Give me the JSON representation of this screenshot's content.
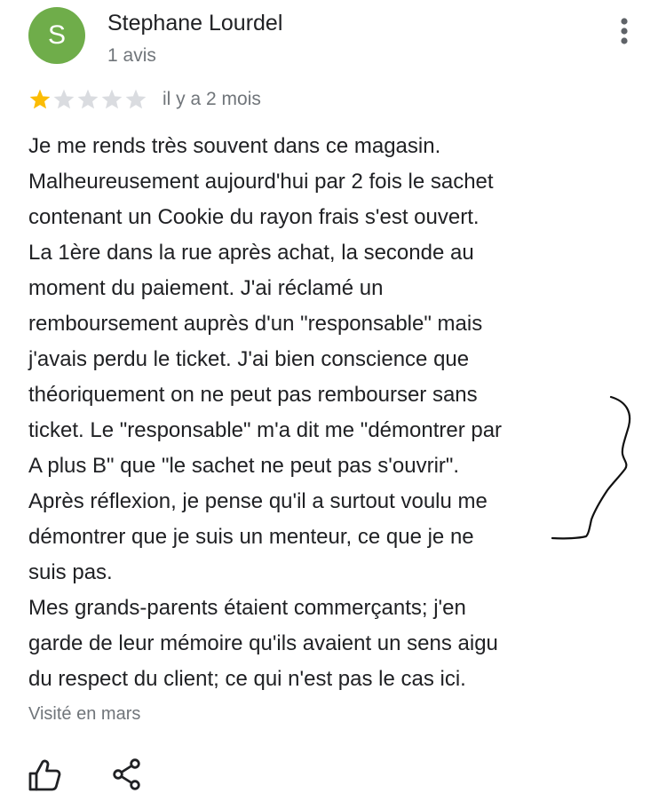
{
  "review": {
    "avatar_letter": "S",
    "avatar_color": "#6fad4a",
    "author_name": "Stephane Lourdel",
    "author_meta": "1 avis",
    "rating": 1,
    "max_rating": 5,
    "star_filled_color": "#fbbc04",
    "star_empty_color": "#dadce0",
    "time_ago": "il y a 2 mois",
    "text_lines": [
      "Je me rends très souvent dans ce magasin.",
      "Malheureusement aujourd'hui par 2 fois le sachet",
      "contenant un Cookie du rayon frais s'est ouvert.",
      "La 1ère dans la rue après achat, la seconde au",
      "moment du paiement. J'ai réclamé un",
      "remboursement auprès d'un \"responsable\" mais",
      "j'avais perdu le ticket. J'ai bien conscience que",
      "théoriquement on ne peut pas rembourser sans",
      "ticket. Le \"responsable\" m'a dit me \"démontrer par",
      "A plus B\" que \"le sachet ne peut pas s'ouvrir\".",
      "Après réflexion, je pense qu'il a surtout voulu me",
      "démontrer que je suis un menteur, ce que je ne",
      "suis pas.",
      "Mes grands-parents étaient commerçants; j'en",
      "garde de leur mémoire qu'ils avaient un sens aigu",
      "du respect du client; ce qui n'est pas le cas ici."
    ],
    "visited": "Visité en mars"
  },
  "icons": {
    "menu": "more-vert-icon",
    "like": "thumb-up-icon",
    "share": "share-icon"
  }
}
